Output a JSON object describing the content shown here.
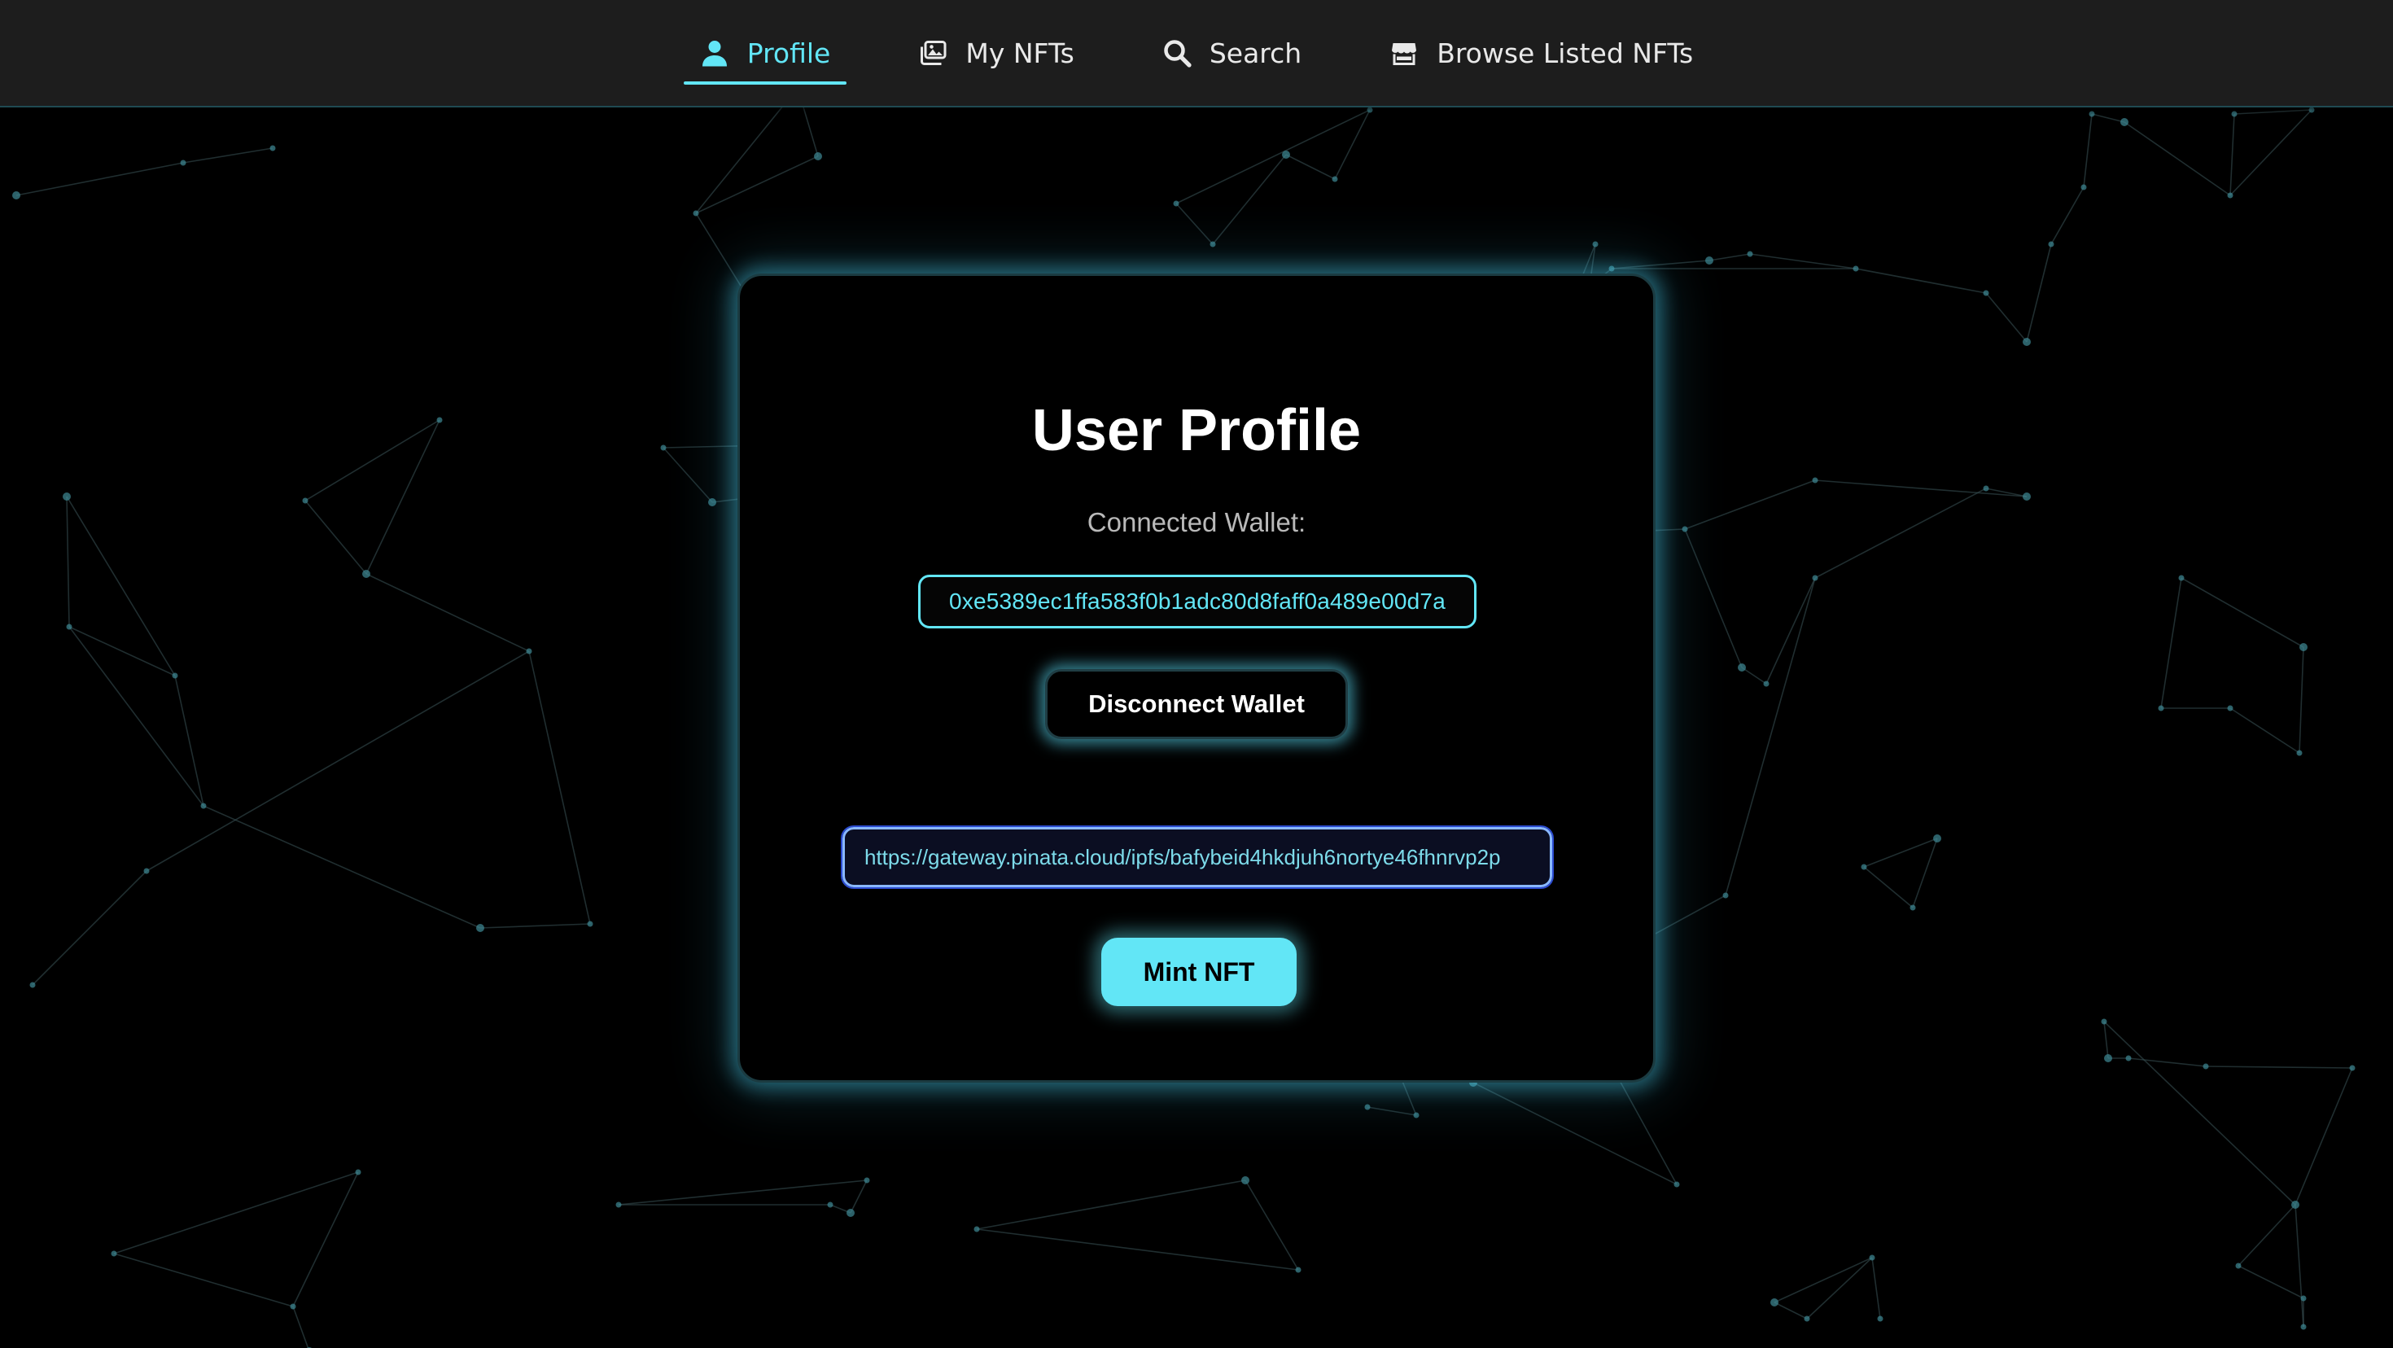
{
  "colors": {
    "accent": "#62e6f6",
    "nav_background": "#1d1d1d",
    "page_background": "#000000",
    "network_lines": "#3a5358",
    "network_nodes": "#3f8a96"
  },
  "nav": {
    "items": [
      {
        "label": "Profile",
        "icon": "user-icon",
        "active": true
      },
      {
        "label": "My NFTs",
        "icon": "images-icon",
        "active": false
      },
      {
        "label": "Search",
        "icon": "search-icon",
        "active": false
      },
      {
        "label": "Browse Listed NFTs",
        "icon": "store-icon",
        "active": false
      }
    ]
  },
  "profile": {
    "title": "User Profile",
    "wallet_label": "Connected Wallet:",
    "wallet_address": "0xe5389ec1ffa583f0b1adc80d8faff0a489e00d7a",
    "disconnect_label": "Disconnect Wallet",
    "token_uri_value": "https://gateway.pinata.cloud/ipfs/bafybeid4hkdjuh6nortye46fhnrvp2p",
    "mint_label": "Mint NFT"
  }
}
